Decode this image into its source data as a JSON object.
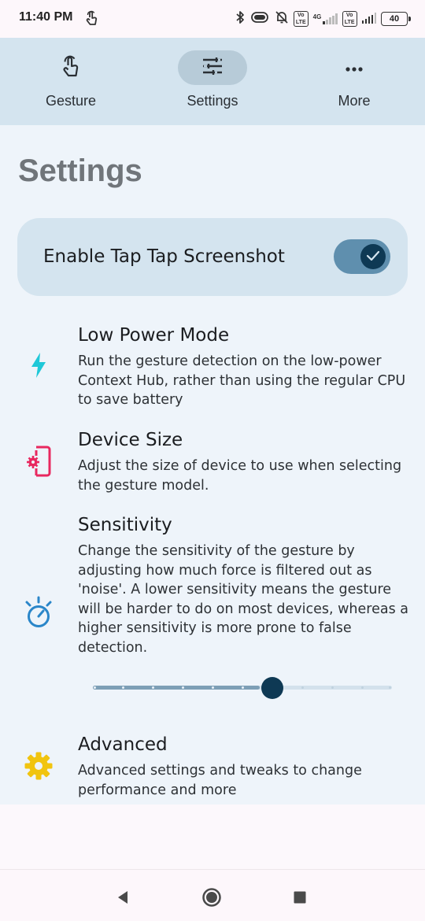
{
  "status_bar": {
    "time": "11:40 PM",
    "battery": "40",
    "net_label": "4G",
    "volte_label": "Vo\nLTE",
    "icons": [
      "gesture-icon",
      "bluetooth-icon",
      "vibrate-icon",
      "notifications-off-icon",
      "volte-icon",
      "signal-icon",
      "battery-icon"
    ]
  },
  "nav": {
    "items": [
      {
        "label": "Gesture",
        "icon": "gesture-icon",
        "active": false
      },
      {
        "label": "Settings",
        "icon": "tune-icon",
        "active": true
      },
      {
        "label": "More",
        "icon": "more-horiz-icon",
        "active": false
      }
    ]
  },
  "page": {
    "title": "Settings"
  },
  "enable": {
    "label": "Enable Tap Tap Screenshot",
    "enabled": true
  },
  "settings": [
    {
      "title": "Low Power Mode",
      "description": "Run the gesture detection on the low-power Context Hub, rather than using the regular CPU to save battery",
      "icon": "bolt-icon",
      "color": "#1fc8d8"
    },
    {
      "title": "Device Size",
      "description": "Adjust the size of device to use when selecting the gesture model.",
      "icon": "phone-settings-icon",
      "color": "#e8285f"
    },
    {
      "title": "Sensitivity",
      "description": "Change the sensitivity of the gesture by adjusting how much force is filtered out as 'noise'. A lower sensitivity means the gesture will be harder to do on most devices, whereas a higher sensitivity is more prone to false detection.",
      "icon": "timer-icon",
      "color": "#2a86c9"
    },
    {
      "title": "Advanced",
      "description": "Advanced settings and tweaks to change performance and more",
      "icon": "gear-icon",
      "color": "#f1c40f"
    }
  ],
  "sensitivity_slider": {
    "value_fraction": 0.6,
    "steps": 10
  },
  "colors": {
    "accent": "#0e3954",
    "surface": "#eef4fa",
    "nav_surface": "#d4e4ef"
  }
}
